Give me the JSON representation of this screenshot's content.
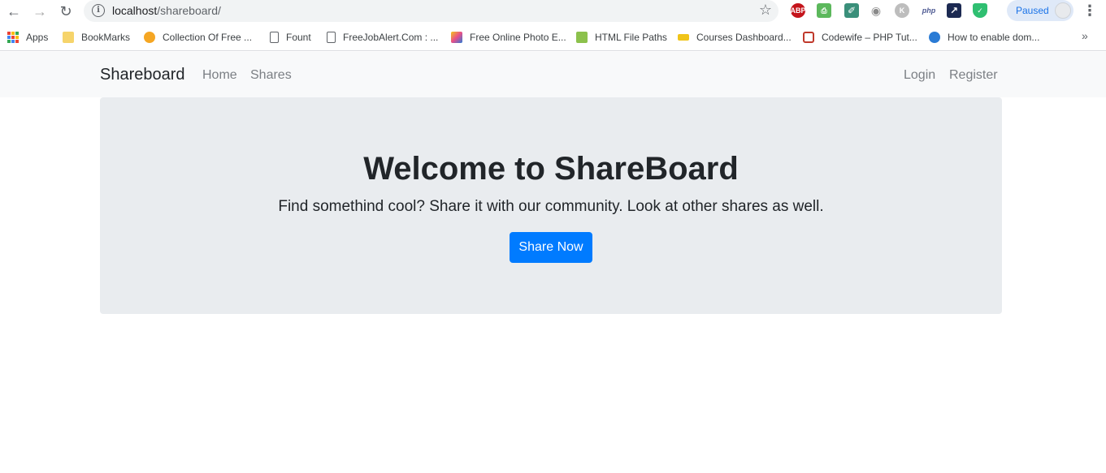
{
  "browser": {
    "url_host": "localhost",
    "url_path": "/shareboard/",
    "profile_label": "Paused",
    "extensions": [
      "abp-icon",
      "print-icon",
      "eyedropper-icon",
      "camera-icon",
      "k-icon",
      "php-icon",
      "arrow-icon",
      "shield-icon"
    ],
    "ext_labels": {
      "abp": "ABP",
      "k": "K",
      "php": "php"
    }
  },
  "bookmarks": [
    {
      "label": "Apps",
      "icon": "apps-grid-icon"
    },
    {
      "label": "BookMarks",
      "icon": "folder-icon",
      "color": "#f6d46b"
    },
    {
      "label": "Collection Of Free ...",
      "icon": "e-icon",
      "color": "#f5a623"
    },
    {
      "label": "Fount",
      "icon": "page-icon",
      "color": "#ffffff"
    },
    {
      "label": "FreeJobAlert.Com : ...",
      "icon": "page-icon",
      "color": "#ffffff"
    },
    {
      "label": "Free Online Photo E...",
      "icon": "photo-icon",
      "color": "#e84e8a"
    },
    {
      "label": "HTML File Paths",
      "icon": "w3-icon",
      "color": "#8cc14c"
    },
    {
      "label": "Courses Dashboard...",
      "icon": "crown-icon",
      "color": "#f0c419"
    },
    {
      "label": "Codewife – PHP Tut...",
      "icon": "cw-icon",
      "color": "#c0392b"
    },
    {
      "label": "How to enable dom...",
      "icon": "ie-icon",
      "color": "#2a7bd5"
    }
  ],
  "navbar": {
    "brand": "Shareboard",
    "links": [
      "Home",
      "Shares"
    ],
    "right_links": [
      "Login",
      "Register"
    ]
  },
  "jumbotron": {
    "title": "Welcome to ShareBoard",
    "lead": "Find somethind cool? Share it with our community. Look at other shares as well.",
    "button": "Share Now"
  },
  "colors": {
    "primary": "#007bff",
    "navbar_bg": "#f8f9fa",
    "jumbotron_bg": "#e9ecef"
  }
}
